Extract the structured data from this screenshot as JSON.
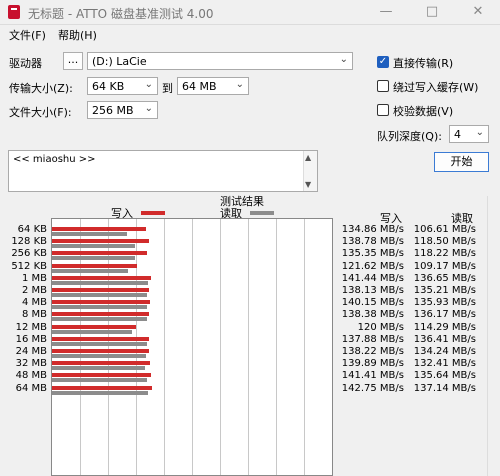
{
  "window": {
    "title": "无标题 - ATTO 磁盘基准测试 4.00"
  },
  "menu": [
    {
      "label": "文件(F)"
    },
    {
      "label": "帮助(H)"
    }
  ],
  "controls": {
    "drive_label": "驱动器",
    "browse_label": "...",
    "drive_value": "(D:) LaCie",
    "transfer_size_label": "传输大小(Z):",
    "transfer_from": "64 KB",
    "to_label": "到",
    "transfer_to": "64 MB",
    "file_size_label": "文件大小(F):",
    "file_size": "256 MB",
    "direct_io_label": "直接传输(R)",
    "direct_io_checked": true,
    "bypass_cache_label": "绕过写入缓存(W)",
    "bypass_cache_checked": false,
    "verify_label": "校验数据(V)",
    "verify_checked": false,
    "queue_depth_label": "队列深度(Q):",
    "queue_depth": "4",
    "start_label": "开始",
    "description": "<< miaoshu >>"
  },
  "results": {
    "title": "测试结果",
    "write_legend": "写入",
    "read_legend": "读取",
    "write_header": "写入",
    "read_header": "读取"
  },
  "colors": {
    "write": "#d12b2b",
    "read": "#8c8c8c"
  },
  "chart_data": {
    "type": "bar",
    "orientation": "horizontal",
    "title": "测试结果",
    "categories": [
      "64 KB",
      "128 KB",
      "256 KB",
      "512 KB",
      "1 MB",
      "2 MB",
      "4 MB",
      "8 MB",
      "12 MB",
      "16 MB",
      "24 MB",
      "32 MB",
      "48 MB",
      "64 MB"
    ],
    "series": [
      {
        "name": "写入",
        "values": [
          134.86,
          138.78,
          135.35,
          121.62,
          141.44,
          138.13,
          140.15,
          138.38,
          120,
          137.88,
          138.22,
          139.89,
          141.41,
          142.75
        ]
      },
      {
        "name": "读取",
        "values": [
          106.61,
          118.5,
          118.22,
          109.17,
          136.65,
          135.21,
          135.93,
          136.17,
          114.29,
          136.41,
          134.24,
          132.41,
          135.64,
          137.14
        ]
      }
    ],
    "value_labels": {
      "write": [
        "134.86 MB/s",
        "138.78 MB/s",
        "135.35 MB/s",
        "121.62 MB/s",
        "141.44 MB/s",
        "138.13 MB/s",
        "140.15 MB/s",
        "138.38 MB/s",
        "120 MB/s",
        "137.88 MB/s",
        "138.22 MB/s",
        "139.89 MB/s",
        "141.41 MB/s",
        "142.75 MB/s"
      ],
      "read": [
        "106.61 MB/s",
        "118.50 MB/s",
        "118.22 MB/s",
        "109.17 MB/s",
        "136.65 MB/s",
        "135.21 MB/s",
        "135.93 MB/s",
        "136.17 MB/s",
        "114.29 MB/s",
        "136.41 MB/s",
        "134.24 MB/s",
        "132.41 MB/s",
        "135.64 MB/s",
        "137.14 MB/s"
      ]
    },
    "xlim": [
      0,
      400
    ],
    "grid": true
  }
}
